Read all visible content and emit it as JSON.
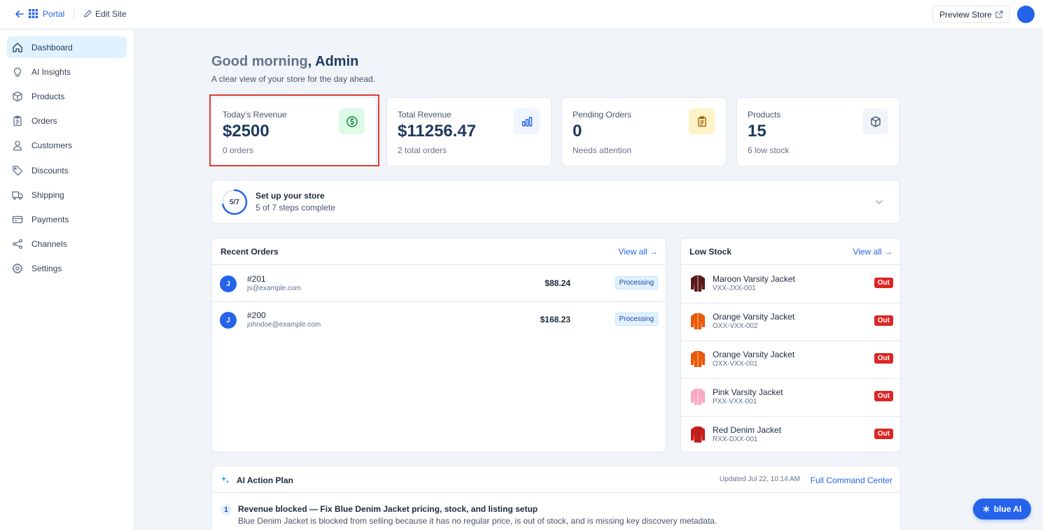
{
  "topbar": {
    "portal_label": "Portal",
    "edit_site_label": "Edit Site",
    "preview_store_label": "Preview Store"
  },
  "sidebar": {
    "items": [
      {
        "label": "Dashboard",
        "icon": "home-icon",
        "active": true
      },
      {
        "label": "AI Insights",
        "icon": "lightbulb-icon"
      },
      {
        "label": "Products",
        "icon": "box-icon"
      },
      {
        "label": "Orders",
        "icon": "clipboard-icon"
      },
      {
        "label": "Customers",
        "icon": "user-icon"
      },
      {
        "label": "Discounts",
        "icon": "tag-icon"
      },
      {
        "label": "Shipping",
        "icon": "truck-icon"
      },
      {
        "label": "Payments",
        "icon": "credit-card-icon"
      },
      {
        "label": "Channels",
        "icon": "share-icon"
      },
      {
        "label": "Settings",
        "icon": "gear-icon"
      }
    ]
  },
  "header": {
    "greeting_prefix": "Good morning",
    "greeting_name": ", Admin",
    "subtitle": "A clear view of your store for the day ahead."
  },
  "stats": [
    {
      "label": "Today's Revenue",
      "value": "$2500",
      "sub": "0 orders",
      "icon": "dollar-icon"
    },
    {
      "label": "Total Revenue",
      "value": "$11256.47",
      "sub": "2 total orders",
      "icon": "bar-chart-icon"
    },
    {
      "label": "Pending Orders",
      "value": "0",
      "sub": "Needs attention",
      "icon": "clipboard-icon"
    },
    {
      "label": "Products",
      "value": "15",
      "sub": "6 low stock",
      "icon": "box-icon"
    }
  ],
  "setup": {
    "progress_label": "5/7",
    "progress_fraction": 0.714,
    "title": "Set up your store",
    "subtitle": "5 of 7 steps complete"
  },
  "recent_orders": {
    "title": "Recent Orders",
    "view_all": "View all →",
    "rows": [
      {
        "initial": "J",
        "number": "#201",
        "email": "js@example.com",
        "amount": "$88.24",
        "status": "Processing"
      },
      {
        "initial": "J",
        "number": "#200",
        "email": "johndoe@example.com",
        "amount": "$168.23",
        "status": "Processing"
      }
    ]
  },
  "low_stock": {
    "title": "Low Stock",
    "view_all": "View all →",
    "rows": [
      {
        "name": "Maroon Varsity Jacket",
        "sku": "VXX-JXX-001",
        "badge": "Out",
        "color": "#5b1a1a"
      },
      {
        "name": "Orange Varsity Jacket",
        "sku": "OXX-VXX-002",
        "badge": "Out",
        "color": "#ea580c"
      },
      {
        "name": "Orange Varsity Jacket",
        "sku": "OXX-VXX-001",
        "badge": "Out",
        "color": "#ea580c"
      },
      {
        "name": "Pink Varsity Jacket",
        "sku": "PXX-VXX-001",
        "badge": "Out",
        "color": "#f9a8c0"
      },
      {
        "name": "Red Denim Jacket",
        "sku": "RXX-DXX-001",
        "badge": "Out",
        "color": "#c81e1e"
      }
    ]
  },
  "ai_plan": {
    "title": "AI Action Plan",
    "updated": "Updated Jul 22, 10:14 AM",
    "link": "Full Command Center",
    "items": [
      {
        "num": "1",
        "title": "Revenue blocked — Fix Blue Denim Jacket pricing, stock, and listing setup",
        "desc": "Blue Denim Jacket is blocked from selling because it has no regular price, is out of stock, and is missing key discovery metadata."
      }
    ]
  },
  "assistant": {
    "label": "blue AI"
  },
  "colors": {
    "accent": "#2563eb",
    "danger": "#dc2626",
    "highlight": "#e53935"
  }
}
